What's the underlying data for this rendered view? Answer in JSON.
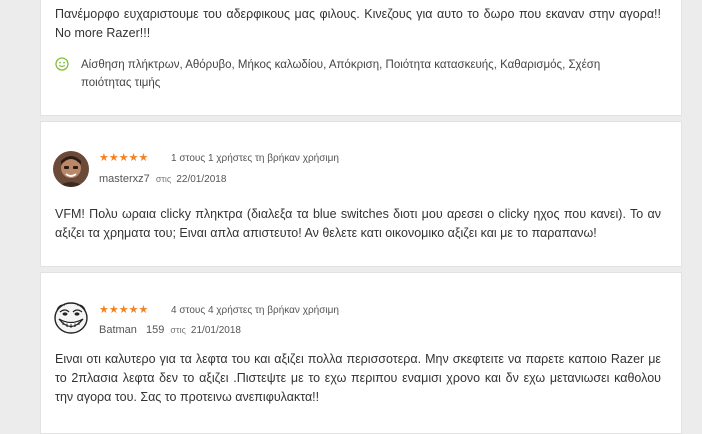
{
  "reviews": [
    {
      "text": "Πανέμορφο ευχαριστουμε του αδερφικους μας φιλους. Κινεζους για αυτο το δωρο που εκαναν στην αγορα!! No more Razer!!!",
      "pros": "Αίσθηση πλήκτρων, Αθόρυβο, Μήκος καλωδίου, Απόκριση, Ποιότητα κατασκευής, Καθαρισμός, Σχέση ποιότητας τιμής",
      "pros_icon": "smile-icon",
      "pros_color": "#7fbf3a"
    },
    {
      "stars": "★★★★★",
      "rating": 5,
      "helpful": "1 στους 1 χρήστες τη βρήκαν χρήσιμη",
      "username": "masterxz7",
      "on": "στις",
      "date": "22/01/2018",
      "text": "VFM! Πολυ ωραια clicky πληκτρα (διαλεξα τα blue switches διοτι μου αρεσει ο clicky ηχος που κανει). Το αν αξιζει τα χρηματα του; Ειναι απλα απιστευτο! Αν θελετε κατι οικονομικο αξιζει και με το παραπανω!"
    },
    {
      "stars": "★★★★★",
      "rating": 5,
      "helpful": "4 στους 4 χρήστες τη βρήκαν χρήσιμη",
      "username": "Batman",
      "points": "159",
      "on": "στις",
      "date": "21/01/2018",
      "text": "Ειναι οτι καλυτερο για τα λεφτα του και αξιζει πολλα περισσοτερα. Μην σκεφτειτε να παρετε καποιο Razer με το 2πλασια λεφτα δεν το αξιζει .Πιστεψτε με το εχω περιπου εναμισι χρονο και δν εχω μετανιωσει καθολου την αγορα του. Σας το προτεινω ανεπιφυλακτα!!"
    }
  ],
  "colors": {
    "star": "#f58220",
    "background": "#ececec",
    "card": "#ffffff"
  }
}
